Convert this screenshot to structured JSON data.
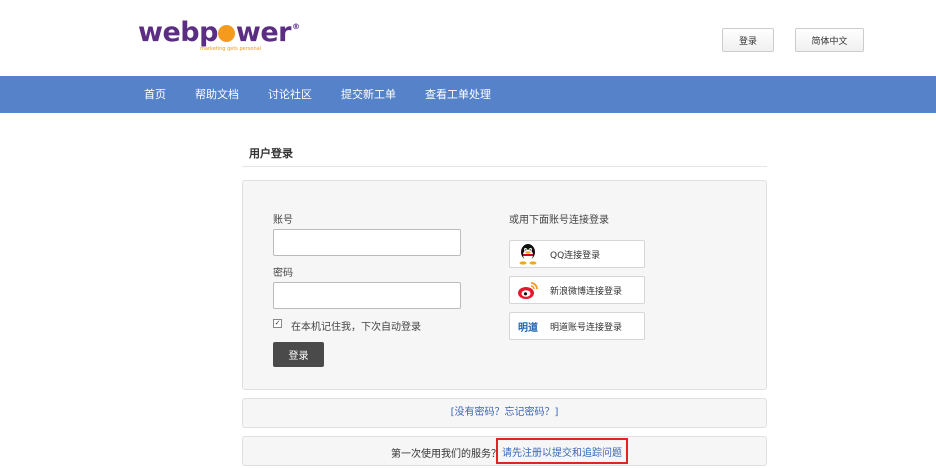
{
  "brand": {
    "logo_text_before": "webp",
    "logo_text_after": "wer",
    "logo_mark": "®",
    "tagline": "marketing gets personal",
    "brand_color": "#5b2d83",
    "accent_color": "#f49a1c"
  },
  "header": {
    "login_label": "登录",
    "language_label": "简体中文"
  },
  "nav": {
    "background": "#5582c8",
    "items": [
      {
        "label": "首页"
      },
      {
        "label": "帮助文档"
      },
      {
        "label": "讨论社区"
      },
      {
        "label": "提交新工单"
      },
      {
        "label": "查看工单处理"
      }
    ]
  },
  "login": {
    "title": "用户登录",
    "account_label": "账号",
    "account_value": "",
    "password_label": "密码",
    "password_value": "",
    "remember_checked": true,
    "remember_mark": "✓",
    "remember_label": "在本机记住我，下次自动登录",
    "submit_label": "登录"
  },
  "social": {
    "heading": "或用下面账号连接登录",
    "providers": [
      {
        "icon": "qq-penguin-icon",
        "label": "QQ连接登录"
      },
      {
        "icon": "weibo-icon",
        "label": "新浪微博连接登录"
      },
      {
        "icon": "mingdao-icon",
        "label": "明道账号连接登录",
        "icon_text": "明道"
      }
    ]
  },
  "links": {
    "forgot": "[没有密码？忘记密码？]"
  },
  "register": {
    "prompt": "第一次使用我们的服务？",
    "link": "请先注册以提交和追踪问题",
    "highlight_color": "#e02424"
  }
}
